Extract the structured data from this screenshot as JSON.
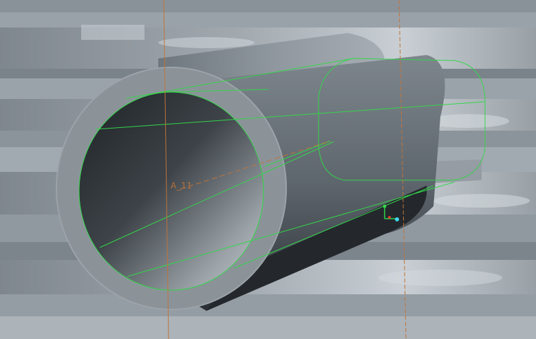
{
  "viewport": {
    "axis_label": "A_11"
  },
  "colors": {
    "background_body": "#8e969d",
    "body_light": "#c3c9cf",
    "body_mid": "#8d959c",
    "body_dark": "#2a2e33",
    "selection_edges": "#33d64a",
    "datum_axis": "#c0743a"
  },
  "icons": {
    "csys_triad": "coordinate-system-icon"
  }
}
